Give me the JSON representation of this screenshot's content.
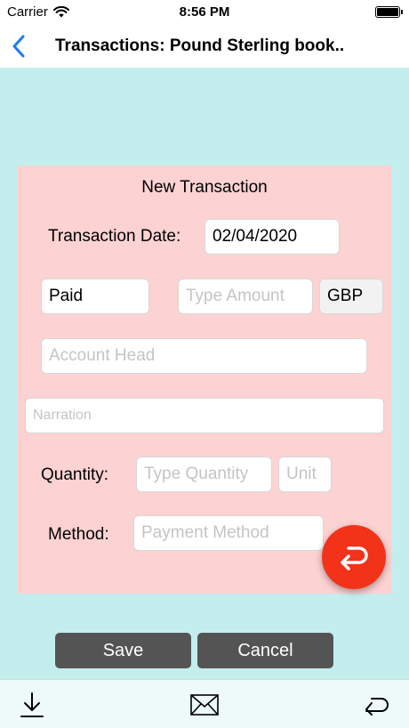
{
  "status_bar": {
    "carrier": "Carrier",
    "time": "8:56 PM",
    "wifi_icon": "wifi-icon",
    "battery_icon": "battery-icon"
  },
  "nav": {
    "back_icon": "chevron-left-icon",
    "title": "Transactions: Pound Sterling book.."
  },
  "form": {
    "heading": "New Transaction",
    "transaction_date_label": "Transaction Date:",
    "transaction_date_value": "02/04/2020",
    "type_value": "Paid",
    "amount_placeholder": "Type Amount",
    "currency_value": "GBP",
    "account_head_placeholder": "Account Head",
    "narration_placeholder": "Narration",
    "quantity_label": "Quantity:",
    "quantity_placeholder": "Type Quantity",
    "unit_placeholder": "Unit",
    "method_label": "Method:",
    "method_placeholder": "Payment Method"
  },
  "actions": {
    "undo_icon": "undo-icon",
    "save_label": "Save",
    "cancel_label": "Cancel"
  },
  "toolbar": {
    "download_icon": "download-icon",
    "mail_icon": "mail-icon",
    "undo_icon": "undo-arrow-icon"
  },
  "colors": {
    "background": "#c4eeee",
    "card": "#fcd2d2",
    "accent_blue": "#1a7cf0",
    "fab_red": "#f3321a",
    "button_gray": "#545454"
  }
}
